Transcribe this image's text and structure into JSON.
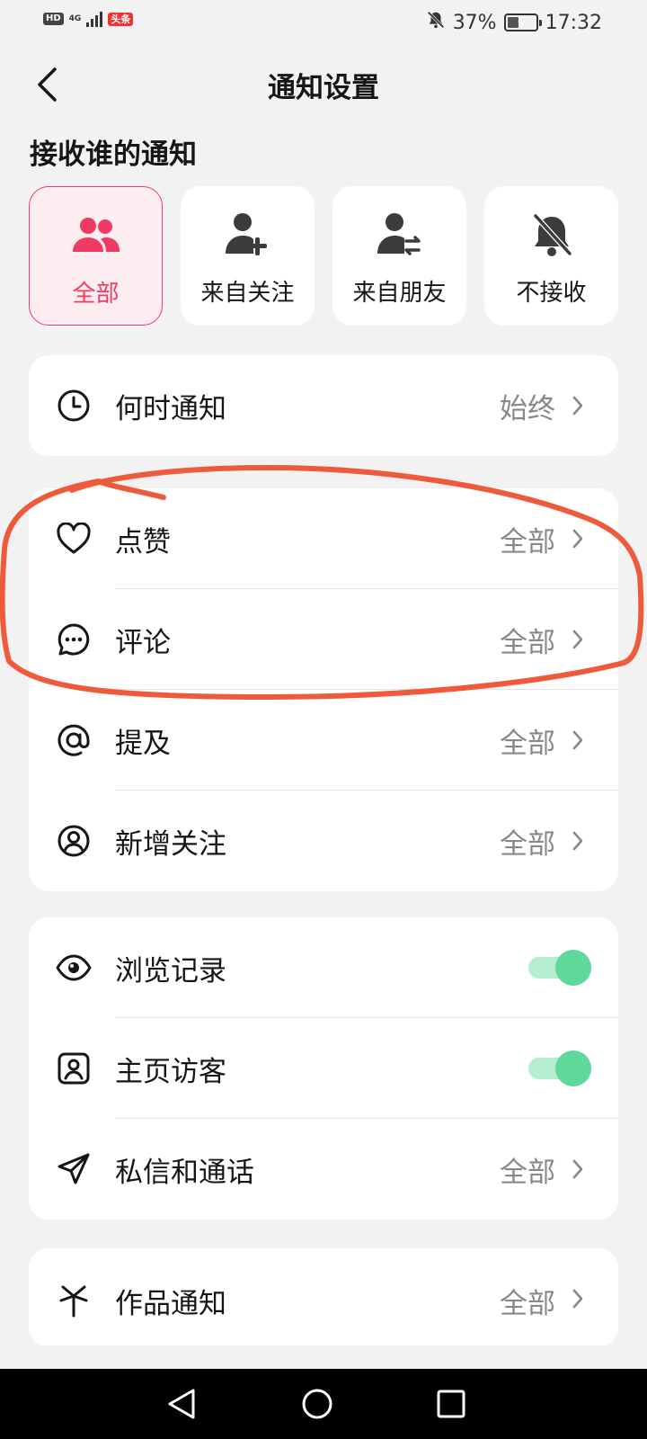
{
  "status_bar": {
    "hd": "HD",
    "network": "4G",
    "app_badge": "头条",
    "battery": "37%",
    "time": "17:32"
  },
  "header": {
    "title": "通知设置"
  },
  "who_section": {
    "title": "接收谁的通知",
    "options": [
      {
        "label": "全部",
        "icon": "group-icon",
        "selected": true
      },
      {
        "label": "来自关注",
        "icon": "user-add-icon",
        "selected": false
      },
      {
        "label": "来自朋友",
        "icon": "user-exchange-icon",
        "selected": false
      },
      {
        "label": "不接收",
        "icon": "bell-off-icon",
        "selected": false
      }
    ]
  },
  "when_card": {
    "label": "何时通知",
    "value": "始终",
    "icon": "clock-icon"
  },
  "interaction_card": [
    {
      "label": "点赞",
      "value": "全部",
      "icon": "heart-icon"
    },
    {
      "label": "评论",
      "value": "全部",
      "icon": "comment-icon"
    },
    {
      "label": "提及",
      "value": "全部",
      "icon": "at-icon"
    },
    {
      "label": "新增关注",
      "value": "全部",
      "icon": "user-circle-icon"
    }
  ],
  "privacy_card": {
    "browse_history": {
      "label": "浏览记录",
      "icon": "eye-icon",
      "enabled": true
    },
    "profile_visitors": {
      "label": "主页访客",
      "icon": "profile-card-icon",
      "enabled": true
    },
    "messages": {
      "label": "私信和通话",
      "value": "全部",
      "icon": "send-icon"
    }
  },
  "works_card": {
    "label": "作品通知",
    "value": "全部",
    "icon": "sparkle-icon"
  },
  "colors": {
    "accent": "#ef3b63",
    "toggle_on": "#5fd89c",
    "annotation": "#ee5a3c"
  }
}
